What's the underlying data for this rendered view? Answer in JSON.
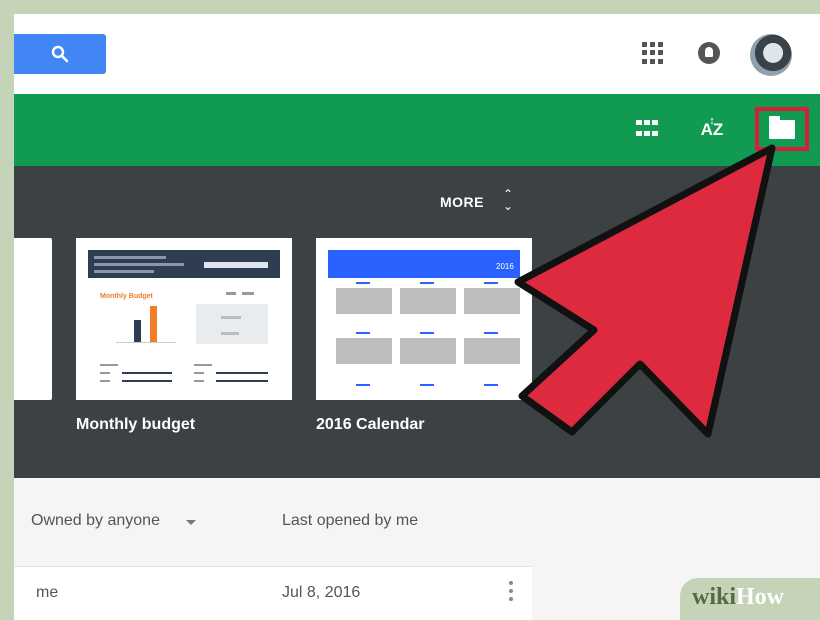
{
  "greenbar": {
    "sort_label": "AZ"
  },
  "templates": {
    "more_label": "MORE",
    "items": [
      {
        "label": "Monthly budget",
        "preview_title": "Monthly Budget"
      },
      {
        "label": "2016 Calendar",
        "preview_year": "2016"
      }
    ]
  },
  "list": {
    "owner_header": "Owned by anyone",
    "date_header": "Last opened by me",
    "rows": [
      {
        "owner": "me",
        "date": "Jul 8, 2016"
      }
    ]
  },
  "watermark": {
    "part1": "wiki",
    "part2": "How"
  },
  "colors": {
    "search": "#4285f4",
    "green_toolbar": "#109a52",
    "dark_panel": "#3c4144",
    "highlight_box": "#d81e3a",
    "arrow": "#dd2a3f"
  }
}
